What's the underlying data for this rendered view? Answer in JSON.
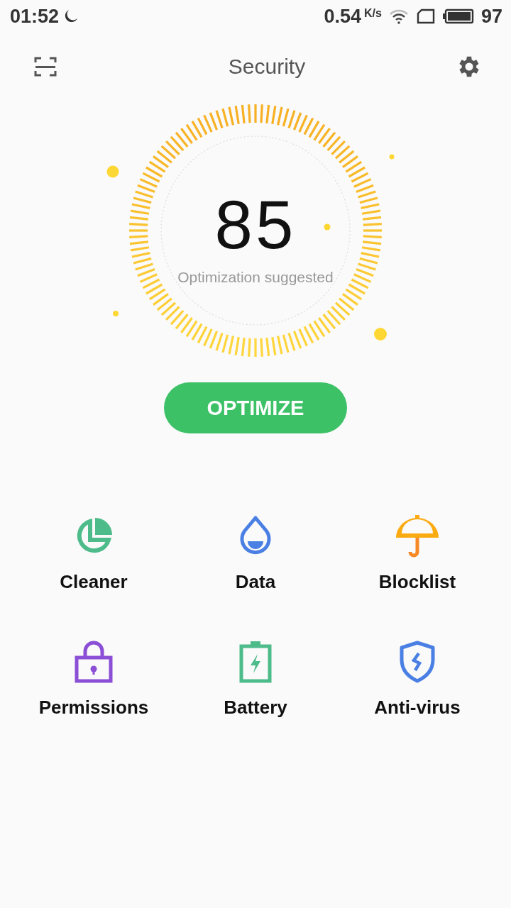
{
  "status_bar": {
    "time": "01:52",
    "speed": "0.54",
    "speed_unit": "K/s",
    "battery": "97"
  },
  "header": {
    "title": "Security"
  },
  "score": {
    "value": "85",
    "caption": "Optimization suggested"
  },
  "action_button": "OPTIMIZE",
  "tools": [
    {
      "label": "Cleaner",
      "kind": "cleaner"
    },
    {
      "label": "Data",
      "kind": "data"
    },
    {
      "label": "Blocklist",
      "kind": "blocklist"
    },
    {
      "label": "Permissions",
      "kind": "permissions"
    },
    {
      "label": "Battery",
      "kind": "battery"
    },
    {
      "label": "Anti-virus",
      "kind": "antivirus"
    }
  ]
}
